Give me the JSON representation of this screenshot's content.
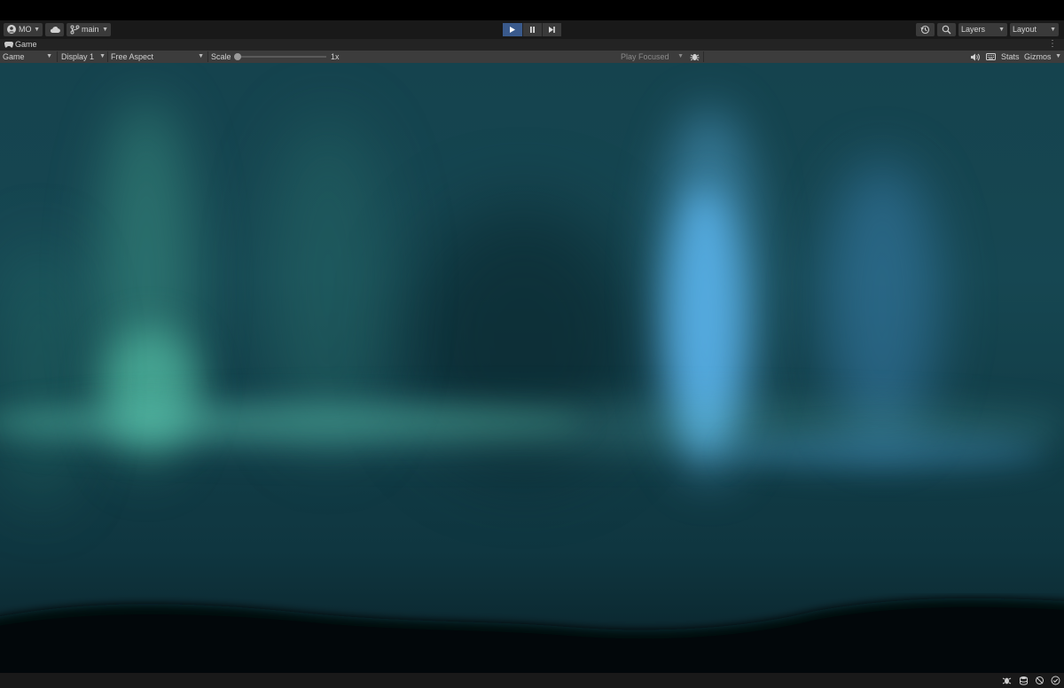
{
  "toolbar": {
    "account": "MO",
    "branch": "main",
    "layers": "Layers",
    "layout": "Layout"
  },
  "tab": {
    "title": "Game"
  },
  "gamebar": {
    "mode": "Game",
    "display": "Display 1",
    "aspect": "Free Aspect",
    "scale_label": "Scale",
    "scale_value": "1x",
    "play_focused": "Play Focused",
    "stats": "Stats",
    "gizmos": "Gizmos"
  },
  "colors": {
    "play_active": "#3a5a8c",
    "aurora_green": "#5fd4b4",
    "aurora_blue": "#62c0ff"
  }
}
